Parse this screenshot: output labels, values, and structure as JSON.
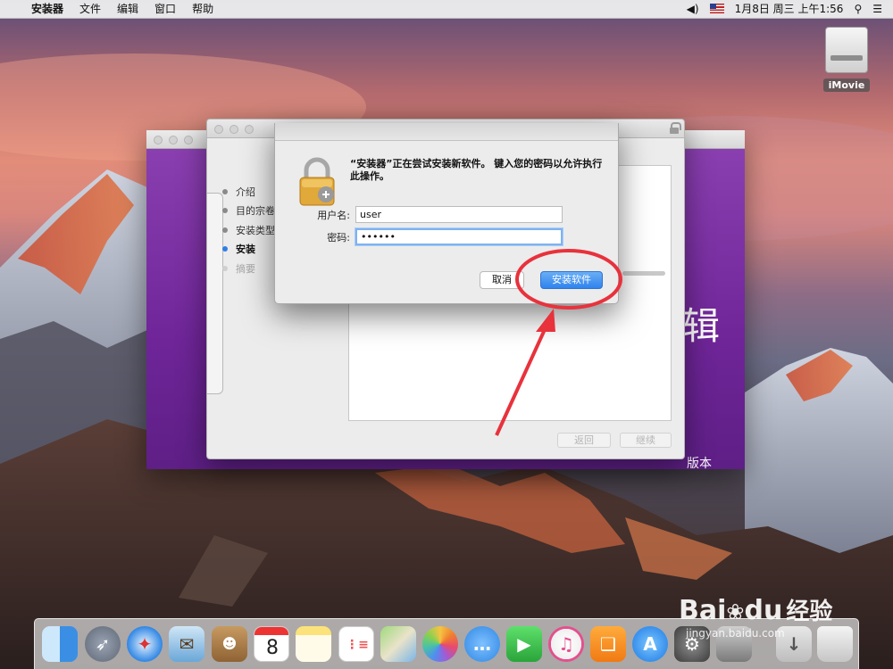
{
  "menubar": {
    "app_name": "安装器",
    "items": [
      "文件",
      "编辑",
      "窗口",
      "帮助"
    ],
    "volume_icon": "volume-icon",
    "input_flag": "us-flag-icon",
    "clock": "1月8日 周三 上午1:56",
    "search_icon": "spotlight-search-icon",
    "list_icon": "notification-list-icon"
  },
  "desktop": {
    "drive_label": "iMovie"
  },
  "installer_back": {
    "partial_title": "辑",
    "version_text": "版本"
  },
  "installer": {
    "steps": [
      {
        "label": "介绍",
        "state": "done"
      },
      {
        "label": "目的宗卷",
        "state": "done"
      },
      {
        "label": "安装类型",
        "state": "done"
      },
      {
        "label": "安装",
        "state": "active"
      },
      {
        "label": "摘要",
        "state": "pending"
      }
    ],
    "back_button": "返回",
    "continue_button": "继续"
  },
  "auth_dialog": {
    "message": "“安装器”正在尝试安装新软件。 键入您的密码以允许执行此操作。",
    "username_label": "用户名:",
    "username_value": "user",
    "password_label": "密码:",
    "password_value": "••••••",
    "cancel_button": "取消",
    "install_button": "安装软件"
  },
  "dock": {
    "items": [
      "finder",
      "launchpad",
      "safari",
      "mail",
      "contacts",
      "calendar",
      "notes",
      "reminders",
      "maps",
      "photos",
      "messages",
      "facetime",
      "itunes",
      "ibooks",
      "app-store",
      "system-preferences",
      "disk-utility",
      "downloads",
      "trash"
    ],
    "calendar_day": "8"
  },
  "watermark": {
    "brand": "Bai",
    "brand2": "du",
    "cn": "经验",
    "url": "jingyan.baidu.com"
  },
  "colors": {
    "accent_blue": "#2f83ee",
    "annotation_red": "#e8323c",
    "installer_purple": "#7a2aa3"
  }
}
